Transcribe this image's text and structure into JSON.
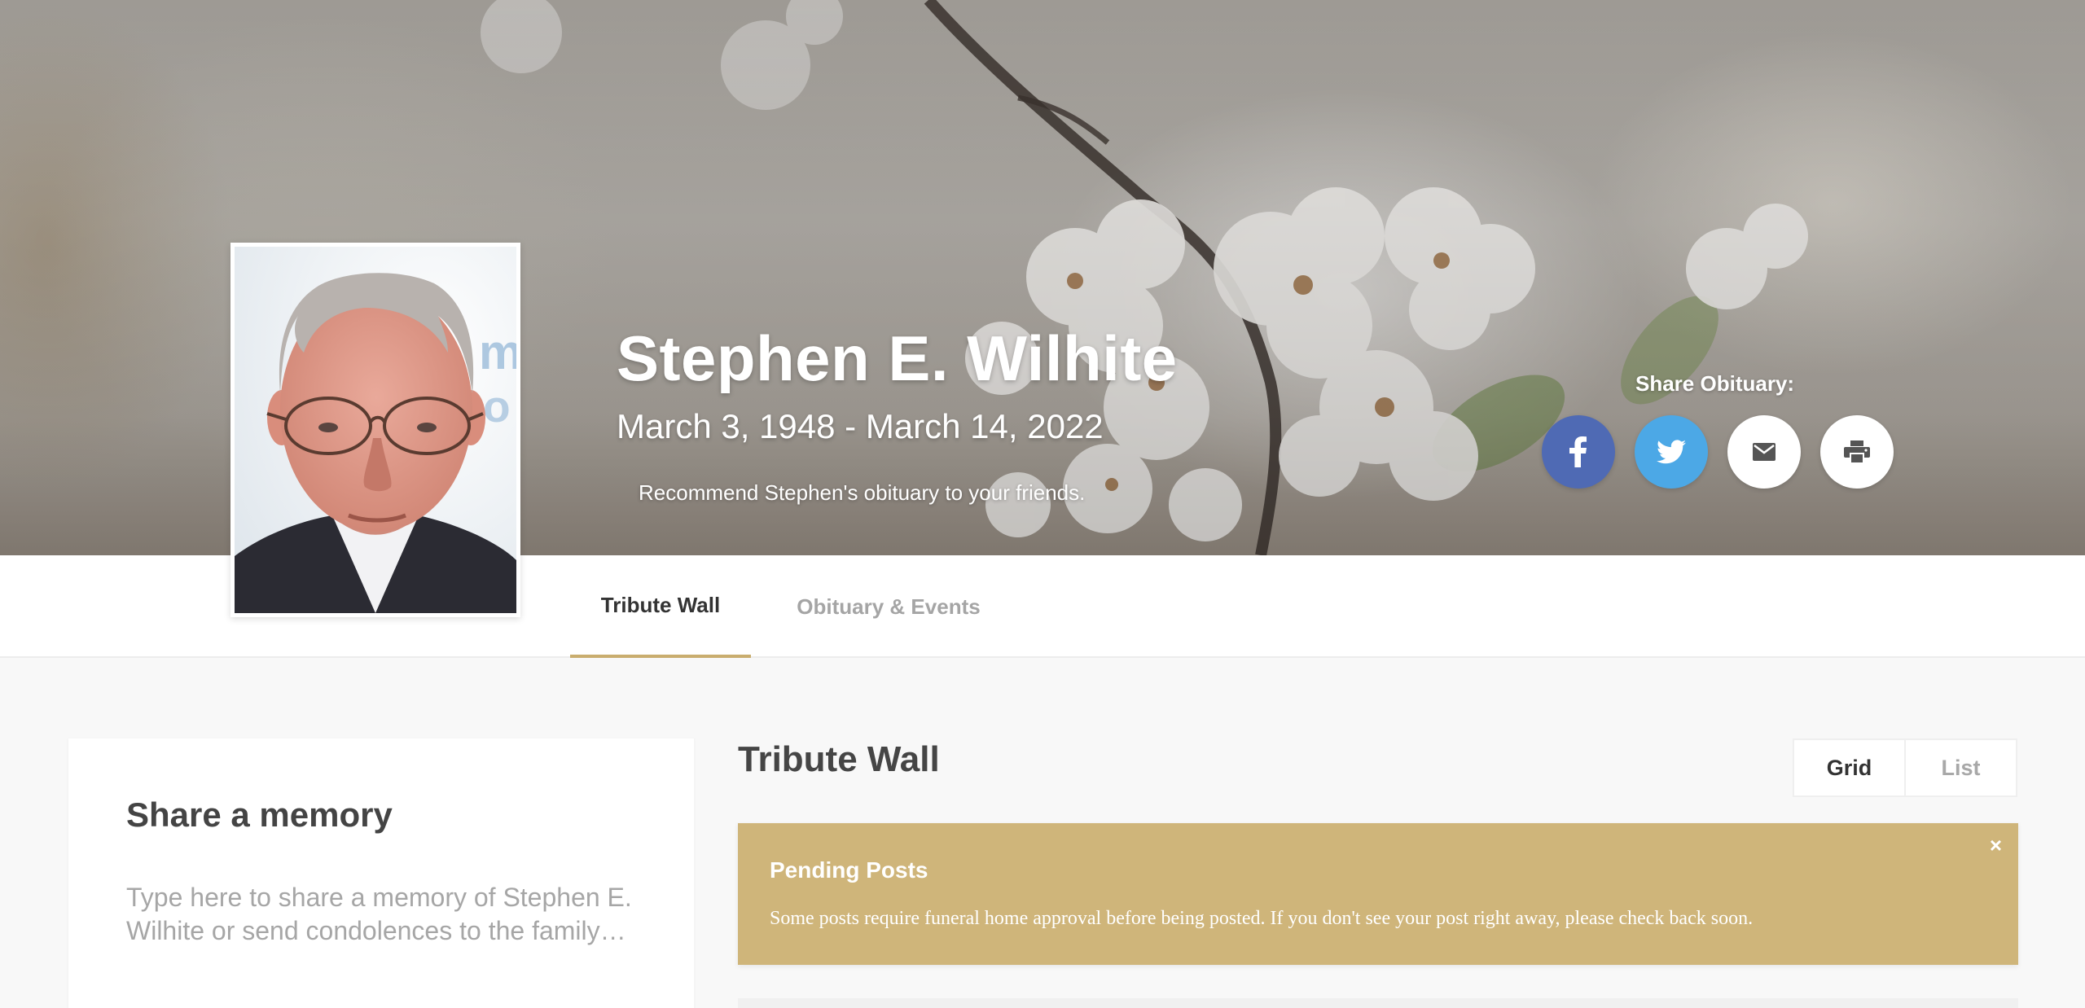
{
  "hero": {
    "name": "Stephen E. Wilhite",
    "dates": "March 3, 1948 - March 14, 2022",
    "recommend": "Recommend Stephen's obituary to your friends.",
    "share_title": "Share Obituary:",
    "share_buttons": [
      "facebook-icon",
      "twitter-icon",
      "mail-icon",
      "print-icon"
    ],
    "colors": {
      "facebook": "#4f6ab4",
      "twitter": "#4ca8e6"
    }
  },
  "tabs": [
    {
      "label": "Tribute Wall",
      "active": true
    },
    {
      "label": "Obituary & Events",
      "active": false
    }
  ],
  "memory": {
    "title": "Share a memory",
    "placeholder": "Type here to share a memory of Stephen E. Wilhite or send condolences to the family…"
  },
  "wall": {
    "title": "Tribute Wall",
    "view_options": [
      "Grid",
      "List"
    ],
    "selected_view": "Grid"
  },
  "pending": {
    "title": "Pending Posts",
    "text": "Some posts require funeral home approval before being posted. If you don't see your post right away, please check back soon.",
    "close": "×",
    "color": "#cfb57a"
  },
  "accent": "#c9ad6e"
}
